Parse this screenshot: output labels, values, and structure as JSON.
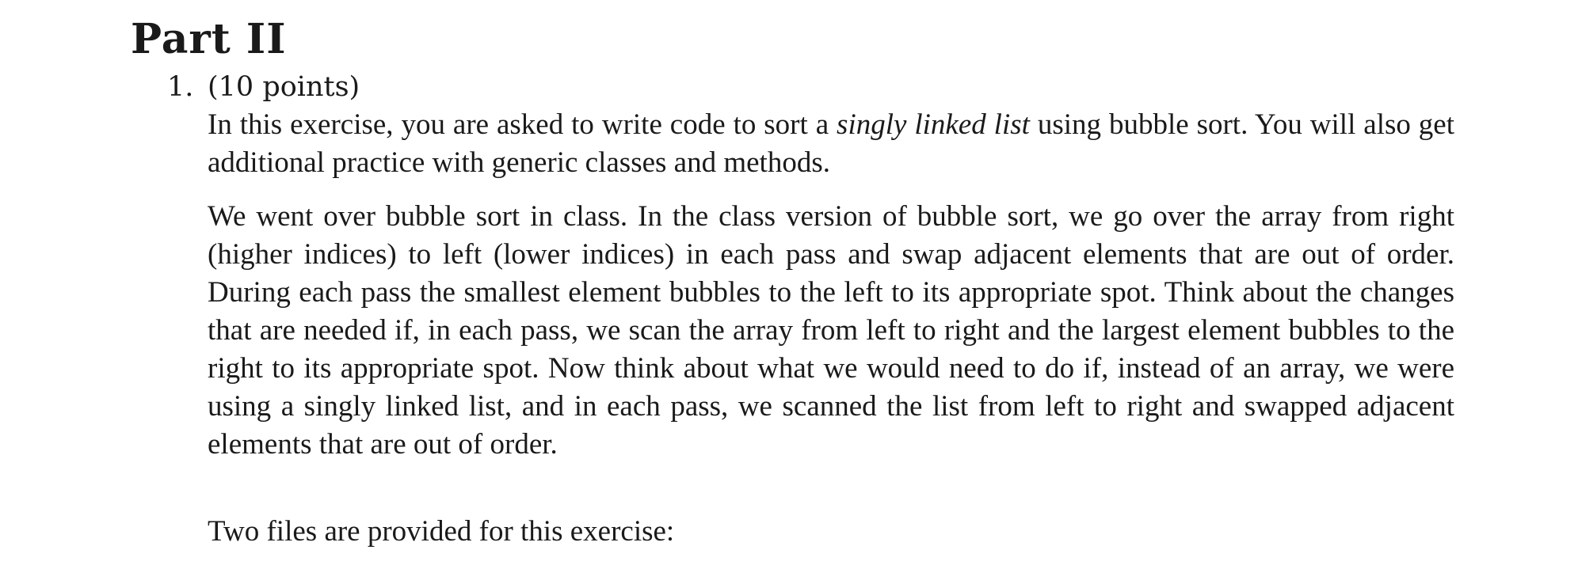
{
  "section": {
    "title": "Part II"
  },
  "item": {
    "number": "1.",
    "points": "(10 points)"
  },
  "paragraphs": {
    "intro": {
      "before": "In this exercise, you are asked to write code to sort a ",
      "emphasis": "singly linked list",
      "after": " using bubble sort. You will also get additional practice with generic classes and methods."
    },
    "body": "We went over bubble sort in class. In the class version of bubble sort, we go over the array from right (higher indices) to left (lower indices) in each pass and swap adjacent elements that are out of order. During each pass the smallest element bubbles to the left to its appropriate spot. Think about the changes that are needed if, in each pass, we scan the array from left to right and the largest element bubbles to the right to its appropriate spot. Now think about what we would need to do if, instead of an array, we were using a singly linked list, and in each pass, we scanned the list from left to right and swapped adjacent elements that are out of order.",
    "files": "Two files are provided for this exercise:"
  }
}
